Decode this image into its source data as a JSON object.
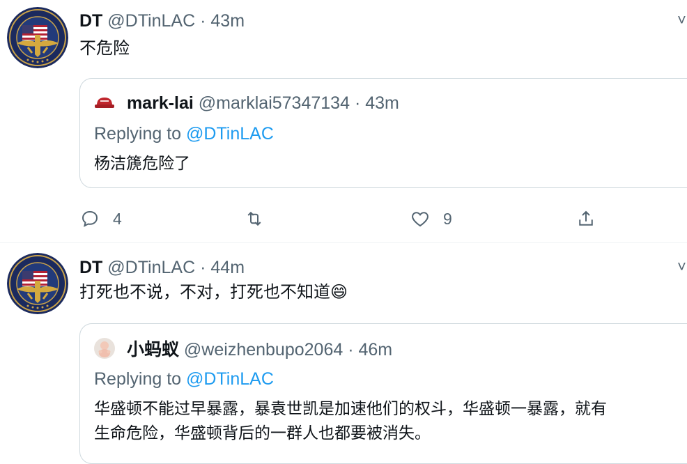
{
  "tweets": [
    {
      "name": "DT",
      "handle": "@DTinLAC",
      "time": "· 43m",
      "text": "不危险",
      "avatar_icon": "navy-seal-emblem-icon",
      "quote": {
        "name": "mark-lai",
        "handle": "@marklai57347134",
        "time": "· 43m",
        "replying_prefix": "Replying to ",
        "replying_to": "@DTinLAC",
        "text": "杨洁篪危险了",
        "avatar_icon": "red-hat-icon"
      },
      "actions": {
        "reply_count": "4",
        "retweet_count": "",
        "like_count": "9"
      }
    },
    {
      "name": "DT",
      "handle": "@DTinLAC",
      "time": "· 44m",
      "text": "打死也不说，不对，打死也不知道😄",
      "avatar_icon": "navy-seal-emblem-icon",
      "quote": {
        "name": "小蚂蚁",
        "handle": "@weizhenbupo2064",
        "time": "· 46m",
        "replying_prefix": "Replying to ",
        "replying_to": "@DTinLAC",
        "text_line1": "华盛顿不能过早暴露，暴袁世凯是加速他们的权斗，华盛顿一暴露，就有",
        "text_line2": "生命危险，华盛顿背后的一群人也都要被消失。",
        "avatar_icon": "baby-doll-icon"
      }
    }
  ],
  "colors": {
    "text": "#0f1419",
    "secondary": "#536471",
    "border": "#cfd9de",
    "link": "#1d9bf0"
  }
}
